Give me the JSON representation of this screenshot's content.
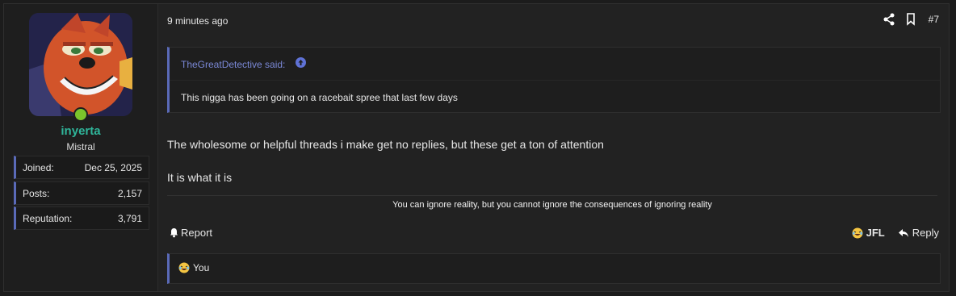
{
  "post": {
    "user": {
      "name": "inyerta",
      "title": "Mistral",
      "stats": [
        {
          "label": "Joined:",
          "value": "Dec 25, 2025"
        },
        {
          "label": "Posts:",
          "value": "2,157"
        },
        {
          "label": "Reputation:",
          "value": "3,791"
        }
      ]
    },
    "time": "9 minutes ago",
    "number": "#7",
    "quote": {
      "author": "TheGreatDetective said:",
      "text": "This nigga has been going on a racebait spree that last few days"
    },
    "message": [
      "The wholesome or helpful threads i make get no replies, but these get a ton of attention",
      "It is what it is"
    ],
    "signature": "You can ignore reality, but you cannot ignore the consequences of ignoring reality",
    "actions": {
      "report": "Report",
      "reaction": "JFL",
      "reply": "Reply"
    },
    "reactions_summary": "You"
  },
  "colors": {
    "accent": "#5a6ab8",
    "username": "#2fb59a",
    "online": "#7bc42c"
  }
}
